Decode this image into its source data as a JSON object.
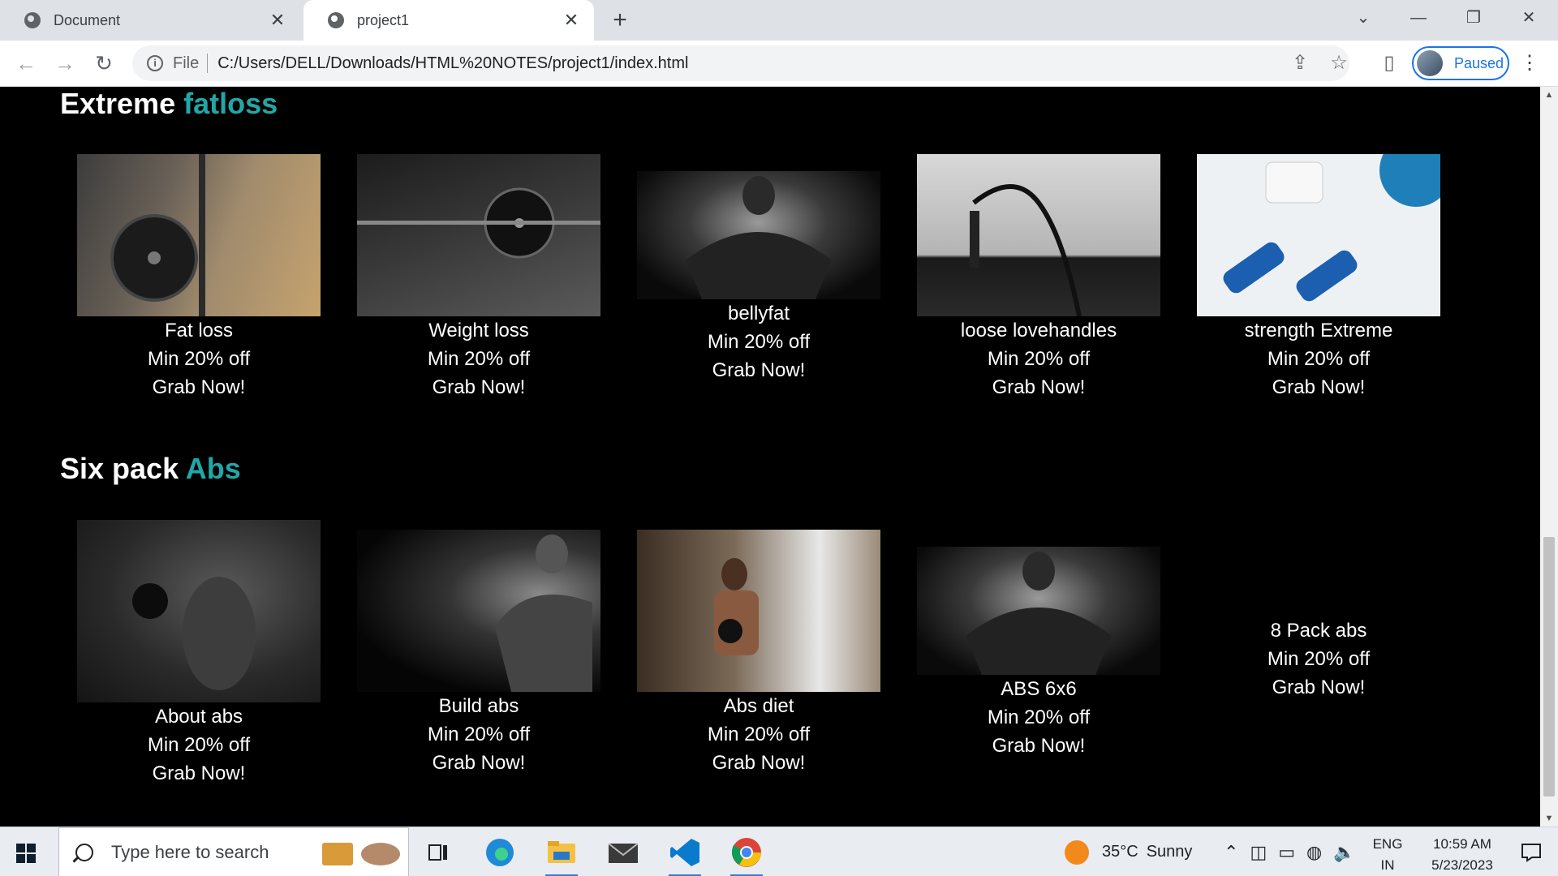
{
  "browser": {
    "tabs": [
      {
        "title": "Document",
        "active": false
      },
      {
        "title": "project1",
        "active": true
      }
    ],
    "new_tab_label": "+",
    "address": {
      "scheme_label": "File",
      "url": "C:/Users/DELL/Downloads/HTML%20NOTES/project1/index.html"
    },
    "profile_label": "Paused"
  },
  "page": {
    "sections": [
      {
        "title_main": "Extreme",
        "title_accent": "fatloss",
        "cards": [
          {
            "name": "Fat loss",
            "offer": "Min 20% off",
            "cta": "Grab Now!"
          },
          {
            "name": "Weight loss",
            "offer": "Min 20% off",
            "cta": "Grab Now!"
          },
          {
            "name": "bellyfat",
            "offer": "Min 20% off",
            "cta": "Grab Now!"
          },
          {
            "name": "loose lovehandles",
            "offer": "Min 20% off",
            "cta": "Grab Now!"
          },
          {
            "name": "strength Extreme",
            "offer": "Min 20% off",
            "cta": "Grab Now!"
          }
        ]
      },
      {
        "title_main": "Six pack",
        "title_accent": "Abs",
        "cards": [
          {
            "name": "About abs",
            "offer": "Min 20% off",
            "cta": "Grab Now!"
          },
          {
            "name": "Build abs",
            "offer": "Min 20% off",
            "cta": "Grab Now!"
          },
          {
            "name": "Abs diet",
            "offer": "Min 20% off",
            "cta": "Grab Now!"
          },
          {
            "name": "ABS 6x6",
            "offer": "Min 20% off",
            "cta": "Grab Now!"
          },
          {
            "name": "8 Pack abs",
            "offer": "Min 20% off",
            "cta": "Grab Now!"
          }
        ]
      }
    ],
    "accent_color": "#22a7a7"
  },
  "taskbar": {
    "search_placeholder": "Type here to search",
    "weather": {
      "temp": "35°C",
      "condition": "Sunny"
    },
    "lang_line1": "ENG",
    "lang_line2": "IN",
    "time": "10:59 AM",
    "date": "5/23/2023"
  }
}
